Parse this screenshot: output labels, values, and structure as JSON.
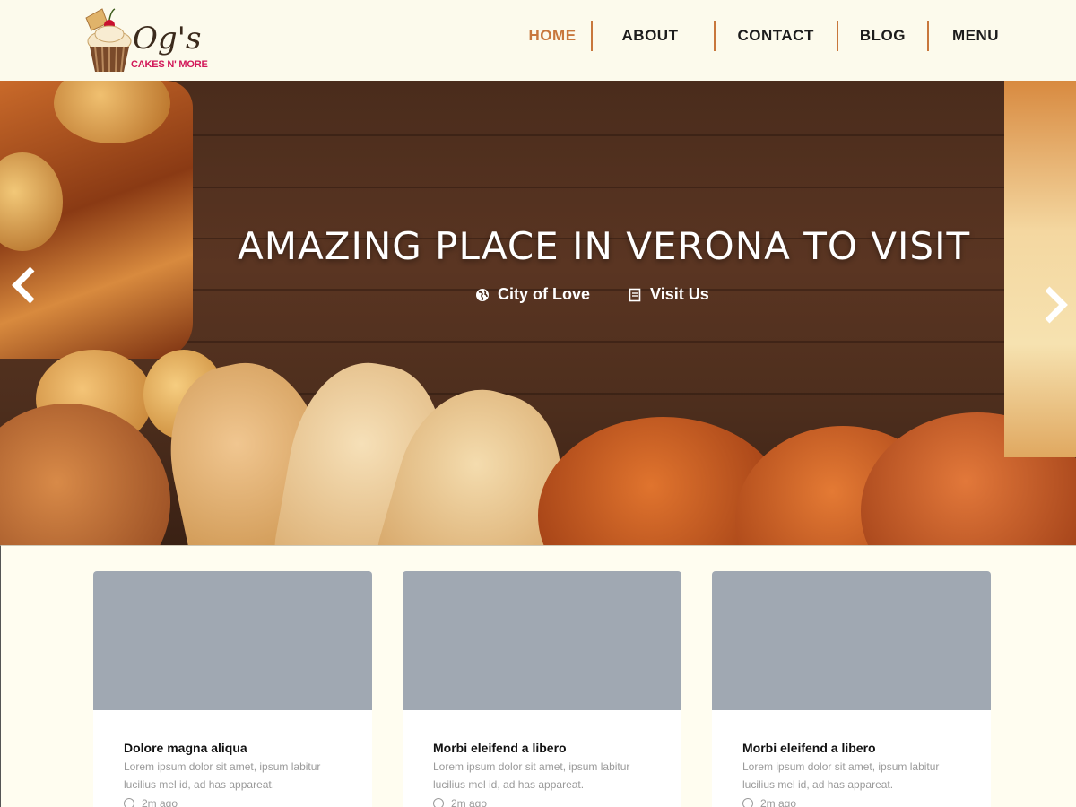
{
  "brand": {
    "script": "Og's",
    "subtitle": "CAKES N' MORE"
  },
  "nav": {
    "items": [
      {
        "label": "HOME",
        "active": true
      },
      {
        "label": "ABOUT"
      },
      {
        "label": "CONTACT"
      },
      {
        "label": "BLOG"
      },
      {
        "label": "MENU"
      }
    ],
    "accent_color": "#c8773c"
  },
  "hero": {
    "title": "AMAZING PLACE IN VERONA TO VISIT",
    "meta": [
      {
        "label": "City of Love",
        "icon": "globe-icon"
      },
      {
        "label": "Visit Us",
        "icon": "document-icon"
      }
    ],
    "prev_icon": "chevron-left-icon",
    "next_icon": "chevron-right-icon"
  },
  "cards": [
    {
      "title": "Dolore magna aliqua",
      "text": "Lorem ipsum dolor sit amet, ipsum labitur lucilius mel id, ad has appareat.",
      "time": "2m ago"
    },
    {
      "title": "Morbi eleifend a libero",
      "text": "Lorem ipsum dolor sit amet, ipsum labitur lucilius mel id, ad has appareat.",
      "time": "2m ago"
    },
    {
      "title": "Morbi eleifend a libero",
      "text": "Lorem ipsum dolor sit amet, ipsum labitur lucilius mel id, ad has appareat.",
      "time": "2m ago"
    }
  ]
}
